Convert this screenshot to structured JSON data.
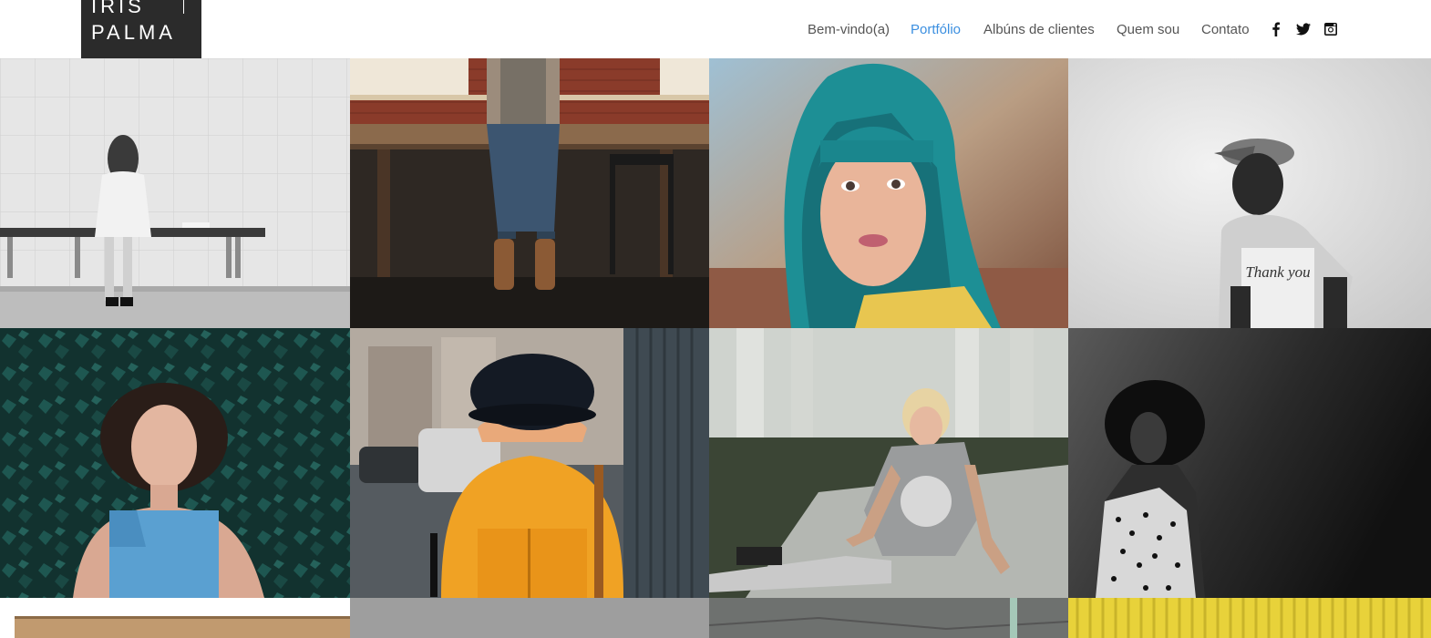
{
  "logo": {
    "line1": "IRIS",
    "line2": "PALMA"
  },
  "nav": {
    "items": [
      {
        "label": "Bem-vindo(a)",
        "active": false
      },
      {
        "label": "Portfólio",
        "active": true
      },
      {
        "label": "Albúns de clientes",
        "active": false
      },
      {
        "label": "Quem sou",
        "active": false
      },
      {
        "label": "Contato",
        "active": false
      }
    ],
    "active_color": "#3b8fe0",
    "social_icons": [
      "facebook-icon",
      "twitter-icon",
      "instagram-icon"
    ]
  },
  "gallery": {
    "photos": [
      "woman-on-bench-bw-photo",
      "woman-sitting-on-table-photo",
      "woman-teal-hair-photo",
      "boy-thank-you-shirt-bw-photo",
      "woman-lying-in-ivy-photo",
      "person-yellow-coat-hat-photo",
      "woman-tattoos-sitting-photo",
      "woman-curly-hair-dark-photo",
      "wooden-sign-photo",
      "gray-photo",
      "pavement-photo",
      "yellow-wall-photo"
    ],
    "thank_you_shirt_text": "Thank you"
  }
}
